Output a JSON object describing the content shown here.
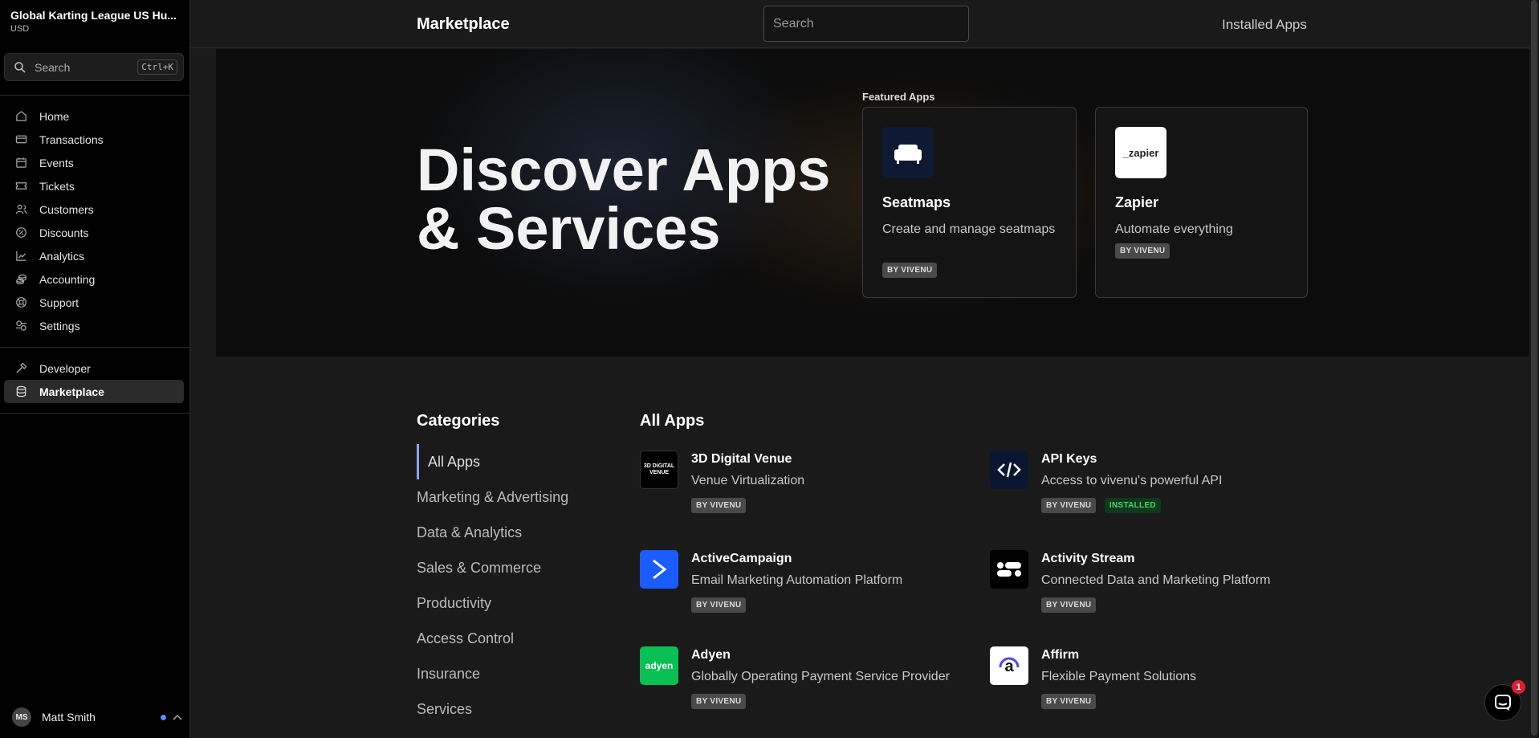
{
  "sidebar": {
    "org_name": "Global Karting League US Hu...",
    "currency": "USD",
    "search": {
      "placeholder": "Search",
      "shortcut": "Ctrl+K"
    },
    "items": [
      {
        "label": "Home",
        "icon": "home-icon"
      },
      {
        "label": "Transactions",
        "icon": "card-icon"
      },
      {
        "label": "Events",
        "icon": "calendar-icon"
      },
      {
        "label": "Tickets",
        "icon": "ticket-icon"
      },
      {
        "label": "Customers",
        "icon": "users-icon"
      },
      {
        "label": "Discounts",
        "icon": "discount-icon"
      },
      {
        "label": "Analytics",
        "icon": "chart-icon"
      },
      {
        "label": "Accounting",
        "icon": "coins-icon"
      },
      {
        "label": "Support",
        "icon": "lifebuoy-icon"
      },
      {
        "label": "Settings",
        "icon": "settings-icon"
      }
    ],
    "secondary": [
      {
        "label": "Developer",
        "icon": "hammer-icon"
      },
      {
        "label": "Marketplace",
        "icon": "database-icon",
        "active": true
      }
    ],
    "user": {
      "initials": "MS",
      "name": "Matt Smith"
    }
  },
  "topbar": {
    "title": "Marketplace",
    "search_placeholder": "Search",
    "installed_link": "Installed Apps"
  },
  "hero": {
    "title_line1": "Discover Apps",
    "title_line2": "& Services",
    "featured_label": "Featured Apps",
    "featured": [
      {
        "name": "Seatmaps",
        "description": "Create and manage seatmaps",
        "badge": "BY VIVENU",
        "icon": "sofa-icon"
      },
      {
        "name": "Zapier",
        "description": "Automate everything",
        "badge": "BY VIVENU",
        "logo_text": "_zapier"
      }
    ]
  },
  "categories": {
    "title": "Categories",
    "items": [
      "All Apps",
      "Marketing & Advertising",
      "Data & Analytics",
      "Sales & Commerce",
      "Productivity",
      "Access Control",
      "Insurance",
      "Services"
    ]
  },
  "apps": {
    "title": "All Apps",
    "list": [
      {
        "name": "3D Digital Venue",
        "description": "Venue Virtualization",
        "badge": "BY VIVENU",
        "logo_text": "3D DIGITAL VENUE"
      },
      {
        "name": "API Keys",
        "description": "Access to vivenu's powerful API",
        "badge": "BY VIVENU",
        "status": "INSTALLED",
        "icon": "code-icon"
      },
      {
        "name": "ActiveCampaign",
        "description": "Email Marketing Automation Platform",
        "badge": "BY VIVENU",
        "icon": "chevron-right-icon"
      },
      {
        "name": "Activity Stream",
        "description": "Connected Data and Marketing Platform",
        "badge": "BY VIVENU",
        "icon": "activity-stream-icon"
      },
      {
        "name": "Adyen",
        "description": "Globally Operating Payment Service Provider",
        "badge": "BY VIVENU",
        "logo_text": "adyen"
      },
      {
        "name": "Affirm",
        "description": "Flexible Payment Solutions",
        "badge": "BY VIVENU",
        "logo_text": "a"
      }
    ]
  },
  "chat": {
    "unread": "1"
  },
  "colors": {
    "accent": "#8aa4ff",
    "installed": "#4fd06f",
    "activecampaign": "#1a5cff",
    "adyen": "#0abf53"
  }
}
